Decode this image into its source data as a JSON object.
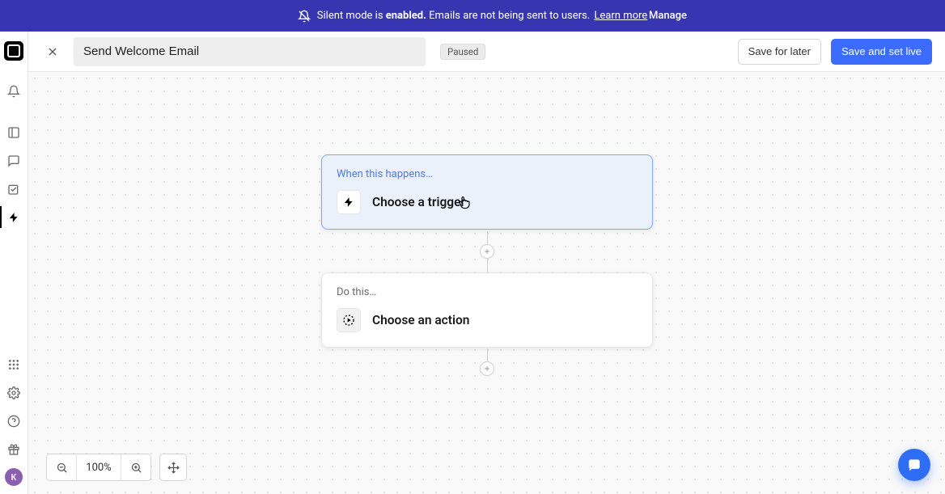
{
  "banner": {
    "prefix": "Silent mode is ",
    "state": "enabled.",
    "suffix": " Emails are not being sent to users. ",
    "learn_more": "Learn more",
    "manage": "Manage"
  },
  "header": {
    "title_value": "Send Welcome Email",
    "status_badge": "Paused",
    "save_later": "Save for later",
    "save_live": "Save and set live"
  },
  "sidebar": {
    "avatar_initial": "K"
  },
  "flow": {
    "trigger": {
      "label": "When this happens…",
      "title": "Choose a trigger"
    },
    "action": {
      "label": "Do this…",
      "title": "Choose an action"
    }
  },
  "zoom": {
    "level": "100%"
  }
}
